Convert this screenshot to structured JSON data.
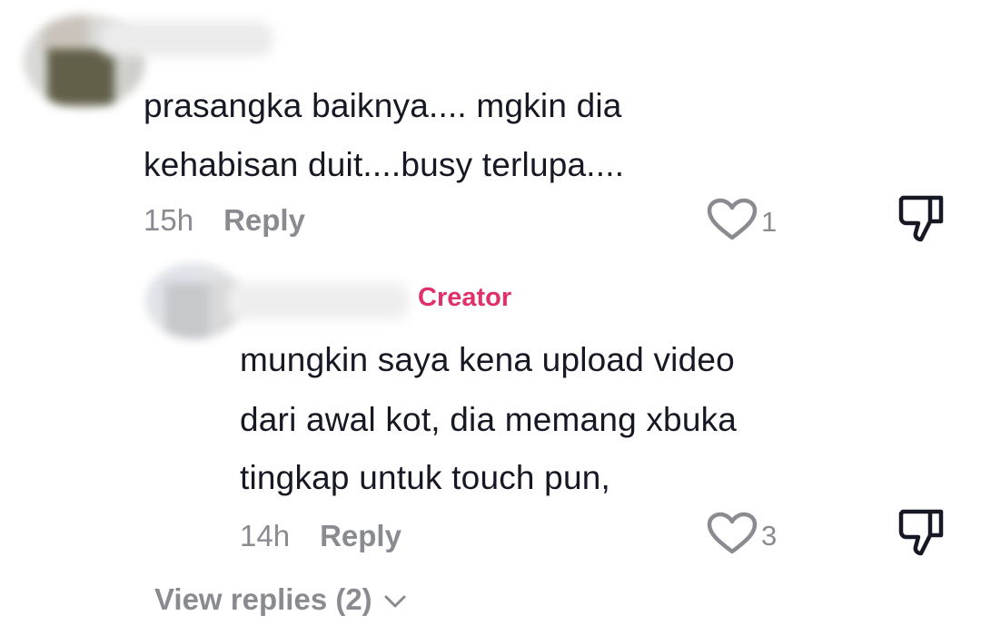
{
  "comment": {
    "text_line1": "prasangka baiknya.... mgkin dia",
    "text_line2": "kehabisan duit....busy terlupa....",
    "time": "15h",
    "reply_label": "Reply",
    "like_count": "1"
  },
  "reply": {
    "badge": "Creator",
    "text_line1": "mungkin saya kena upload video",
    "text_line2": "dari awal kot, dia memang xbuka",
    "text_line3": "tingkap untuk touch pun,",
    "time": "14h",
    "reply_label": "Reply",
    "like_count": "3"
  },
  "view_replies_label": "View replies (2)",
  "colors": {
    "creator_badge": "#e0306a",
    "muted_text": "#8a8b91",
    "primary_text": "#161823"
  }
}
